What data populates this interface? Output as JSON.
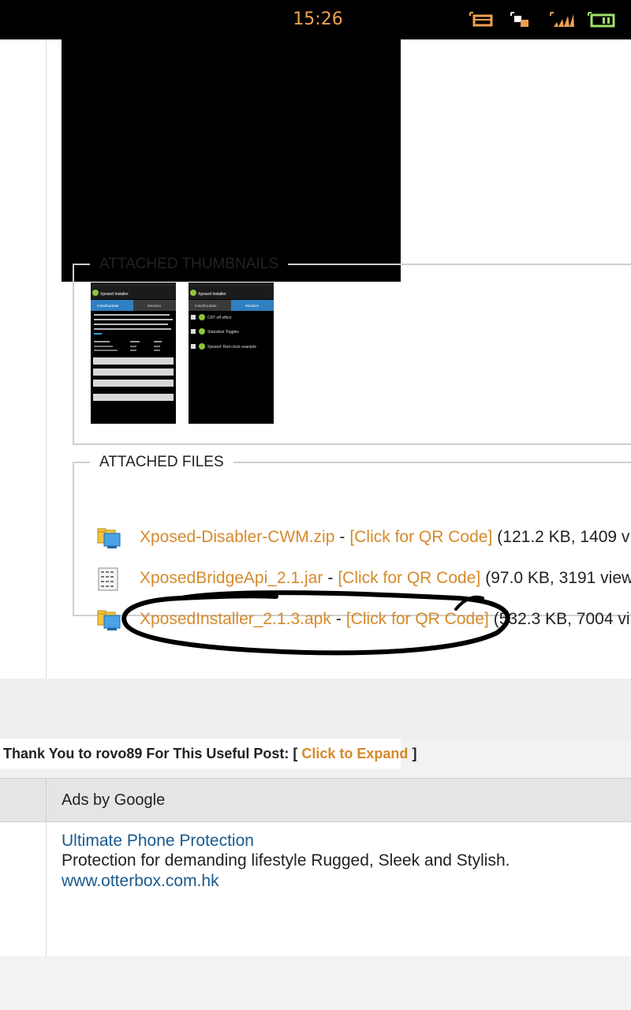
{
  "status_bar": {
    "time": "15:26",
    "accent_color": "#f0a050",
    "icons": [
      "screen-icon",
      "usb-debug-icon",
      "signal-icon",
      "battery-icon"
    ]
  },
  "attached_thumbnails": {
    "title": "ATTACHED THUMBNAILS",
    "thumbnails": [
      {
        "app_title": "Xposed Installer",
        "tabs": [
          "Install/Update",
          "Modules"
        ],
        "active_tab": 0,
        "text": "Here you can install the Xposed framework. It is the base for modules that can change the behaviour and look of your Android phone. For more information please see",
        "buttons": [
          "Install/Update",
          "Uninstall/Reboot...",
          "Reboot",
          "Reboot"
        ]
      },
      {
        "app_title": "Xposed Installer",
        "tabs": [
          "Install/Update",
          "Modules"
        ],
        "active_tab": 1,
        "modules": [
          "CRT off effect",
          "Statusbar Toggles",
          "Xposed: Red clock example"
        ]
      }
    ]
  },
  "attached_files": {
    "title": "ATTACHED FILES",
    "link_color": "#d58a2a",
    "files": [
      {
        "icon": "zip-file-icon",
        "name": "Xposed-Disabler-CWM.zip",
        "separator": "-",
        "qr_label": "[Click for QR Code]",
        "meta": "(121.2 KB, 1409 v"
      },
      {
        "icon": "jar-file-icon",
        "name": "XposedBridgeApi_2.1.jar",
        "separator": "-",
        "qr_label": "[Click for QR Code]",
        "meta": "(97.0 KB, 3191 view"
      },
      {
        "icon": "apk-file-icon",
        "name": "XposedInstaller_2.1.3.apk",
        "separator": "-",
        "qr_label": "[Click for QR Code]",
        "meta": "(532.3 KB, 7004 vi"
      }
    ]
  },
  "thanks": {
    "prefix": "Thank You to rovo89 For This Useful Post: [",
    "link": "Click to Expand",
    "suffix": "]"
  },
  "ads": {
    "header": "Ads by Google",
    "title": "Ultimate Phone Protection",
    "description": "Protection for demanding lifestyle Rugged, Sleek and Stylish.",
    "url": "www.otterbox.com.hk",
    "link_color": "#1a5a8e"
  }
}
